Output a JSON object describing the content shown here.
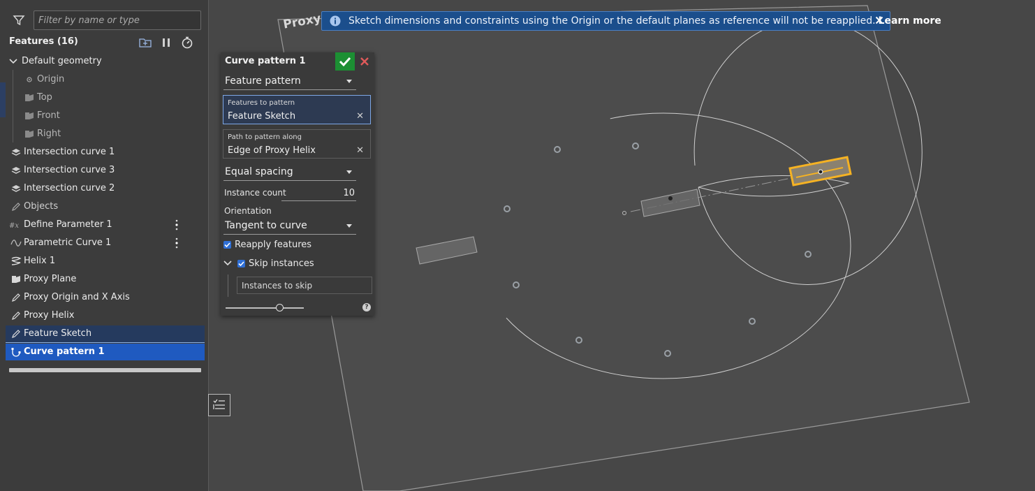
{
  "filter": {
    "placeholder": "Filter by name or type"
  },
  "features": {
    "header": "Features (16)",
    "items": [
      {
        "label": "Default geometry",
        "icon": "chevron-down-icon"
      },
      {
        "label": "Origin",
        "icon": "origin-icon"
      },
      {
        "label": "Top",
        "icon": "plane-icon"
      },
      {
        "label": "Front",
        "icon": "plane-icon"
      },
      {
        "label": "Right",
        "icon": "plane-icon"
      },
      {
        "label": "Intersection curve 1",
        "icon": "curve-icon"
      },
      {
        "label": "Intersection curve 3",
        "icon": "curve-icon"
      },
      {
        "label": "Intersection curve 2",
        "icon": "curve-icon"
      },
      {
        "label": "Objects",
        "icon": "sketch-icon"
      },
      {
        "label": "Define Parameter 1",
        "icon": "variable-icon"
      },
      {
        "label": "Parametric Curve 1",
        "icon": "parametric-icon"
      },
      {
        "label": "Helix 1",
        "icon": "helix-icon"
      },
      {
        "label": "Proxy Plane",
        "icon": "plane-icon"
      },
      {
        "label": "Proxy Origin and X Axis",
        "icon": "sketch-icon"
      },
      {
        "label": "Proxy Helix",
        "icon": "sketch-icon"
      },
      {
        "label": "Feature Sketch",
        "icon": "sketch-icon"
      },
      {
        "label": "Curve pattern 1",
        "icon": "curve-pattern-icon"
      }
    ]
  },
  "dialog": {
    "title": "Curve pattern 1",
    "pattern_type": "Feature pattern",
    "features_to_pattern": {
      "caption": "Features to pattern",
      "value": "Feature Sketch"
    },
    "path": {
      "caption": "Path to pattern along",
      "value": "Edge of Proxy Helix"
    },
    "spacing": "Equal spacing",
    "instance_count_label": "Instance count",
    "instance_count": "10",
    "orientation_label": "Orientation",
    "orientation": "Tangent to curve",
    "reapply_label": "Reapply features",
    "reapply_checked": true,
    "skip_label": "Skip instances",
    "skip_checked": true,
    "skip_placeholder": "Instances to skip"
  },
  "banner": {
    "message": "Sketch dimensions and constraints using the Origin or the default planes as reference will not be reapplied.",
    "link": "Learn more"
  },
  "viewport": {
    "plane_label": "Proxy"
  },
  "colors": {
    "accent": "#1f5ac0",
    "ok": "#1c8f33",
    "cancel": "#e05a5a",
    "highlight": "#f5b223",
    "banner": "#1b4e8c"
  }
}
